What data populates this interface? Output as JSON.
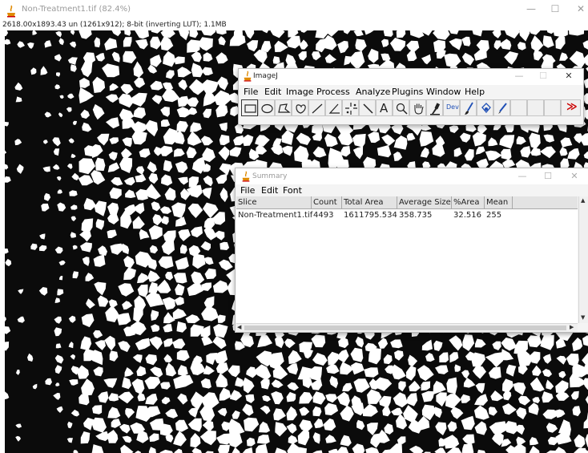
{
  "image_window": {
    "title": "Non-Treatment1.tif (82.4%)",
    "info": "2618.00x1893.43 un (1261x912); 8-bit (inverting LUT); 1.1MB",
    "controls": {
      "minimize": "—",
      "maximize": "☐",
      "close": "✕"
    }
  },
  "imagej": {
    "title": "ImageJ",
    "controls": {
      "minimize": "—",
      "maximize": "☐",
      "close": "✕"
    },
    "menu": [
      "File",
      "Edit",
      "Image",
      "Process",
      "Analyze",
      "Plugins",
      "Window",
      "Help"
    ],
    "tools": [
      {
        "icon": "rectangle-tool-icon"
      },
      {
        "icon": "oval-tool-icon"
      },
      {
        "icon": "polygon-tool-icon"
      },
      {
        "icon": "freehand-tool-icon"
      },
      {
        "icon": "line-tool-icon"
      },
      {
        "icon": "angle-tool-icon"
      },
      {
        "icon": "multipoint-tool-icon"
      },
      {
        "icon": "wand-tool-icon"
      },
      {
        "icon": "text-tool-icon",
        "glyph": "A"
      },
      {
        "icon": "magnifier-tool-icon"
      },
      {
        "icon": "hand-tool-icon"
      },
      {
        "icon": "color-picker-tool-icon"
      },
      {
        "icon": "developer-menu-icon",
        "glyph": "Dev"
      },
      {
        "icon": "brush-tool-icon"
      },
      {
        "icon": "flood-fill-tool-icon"
      },
      {
        "icon": "pencil-tool-icon"
      },
      {
        "icon": "blank-slot"
      },
      {
        "icon": "blank-slot"
      },
      {
        "icon": "blank-slot"
      },
      {
        "icon": "more-tools-icon",
        "glyph": "≫"
      }
    ]
  },
  "summary": {
    "title": "Summary",
    "controls": {
      "minimize": "—",
      "maximize": "☐",
      "close": "✕"
    },
    "menu": [
      "File",
      "Edit",
      "Font"
    ],
    "columns": [
      "Slice",
      "Count",
      "Total Area",
      "Average Size",
      "%Area",
      "Mean"
    ],
    "rows": [
      [
        "Non-Treatment1.tif",
        "4493",
        "1611795.534",
        "358.735",
        "32.516",
        "255"
      ]
    ]
  },
  "colors": {
    "accent_red": "#cc0000",
    "java_orange": "#e08a00",
    "header_bg": "#e3e3e3"
  }
}
